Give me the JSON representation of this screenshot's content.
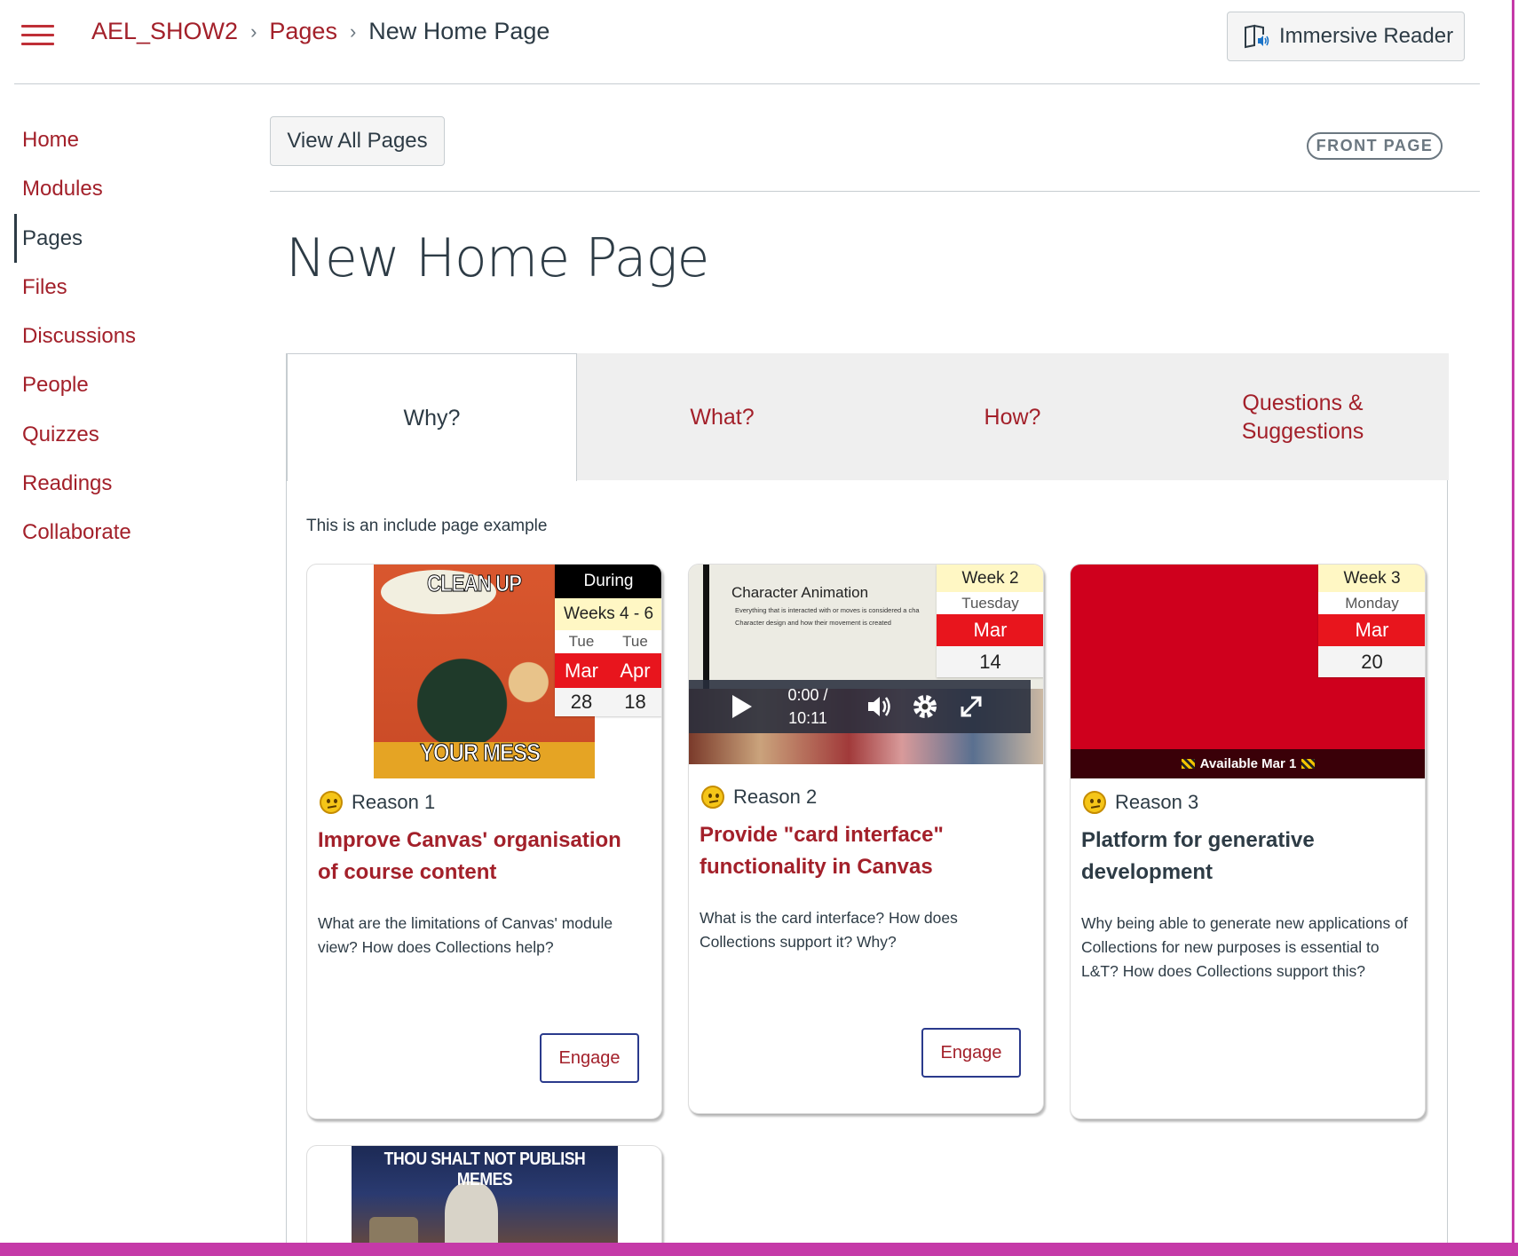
{
  "header": {
    "breadcrumbs": [
      "AEL_SHOW2",
      "Pages",
      "New Home Page"
    ],
    "immersive_reader": "Immersive Reader"
  },
  "nav": {
    "items": [
      "Home",
      "Modules",
      "Pages",
      "Files",
      "Discussions",
      "People",
      "Quizzes",
      "Readings",
      "Collaborate"
    ],
    "active": "Pages"
  },
  "main": {
    "view_all": "View All Pages",
    "front_page_badge": "FRONT PAGE",
    "title": "New Home Page",
    "tabs": [
      "Why?",
      "What?",
      "How?",
      "Questions & Suggestions"
    ],
    "active_tab": "Why?",
    "include_note": "This is an include page example"
  },
  "cards": [
    {
      "image_caption_top": "CLEAN UP",
      "image_caption_bottom": "YOUR MESS",
      "badge": {
        "label": "During",
        "weeks": "Weeks 4 - 6",
        "day1": "Tue",
        "day2": "Tue",
        "mon1": "Mar",
        "mon2": "Apr",
        "num1": "28",
        "num2": "18"
      },
      "reason": "Reason 1",
      "title": "Improve Canvas' organisation of course content",
      "desc": "What are the  limitations of Canvas' module view? How does Collections help?",
      "engage": "Engage"
    },
    {
      "slide_title": "Character Animation",
      "slide_bullets": [
        "Everything that is interacted with or moves is considered a cha",
        "Character design and how their movement is created"
      ],
      "video_time": "0:00 /",
      "video_duration": "10:11",
      "badge": {
        "week": "Week 2",
        "day": "Tuesday",
        "mon": "Mar",
        "num": "14"
      },
      "reason": "Reason 2",
      "title": "Provide \"card interface\" functionality in Canvas",
      "desc": "What is the card interface? How does Collections support it? Why?",
      "engage": "Engage"
    },
    {
      "available": "Available Mar 1",
      "badge": {
        "week": "Week 3",
        "day": "Monday",
        "mon": "Mar",
        "num": "20"
      },
      "reason": "Reason 3",
      "title": "Platform for generative development",
      "desc": "Why being able to generate new applications of Collections for new purposes is essential to L&T? How does Collections support this?"
    },
    {
      "image_caption": "THOU SHALT NOT PUBLISH MEMES"
    }
  ],
  "colors": {
    "brand": "#a3202a",
    "accent_red": "#e8151d",
    "badge_yellow": "#fff7c4",
    "edge_magenta": "#c53aa8"
  }
}
